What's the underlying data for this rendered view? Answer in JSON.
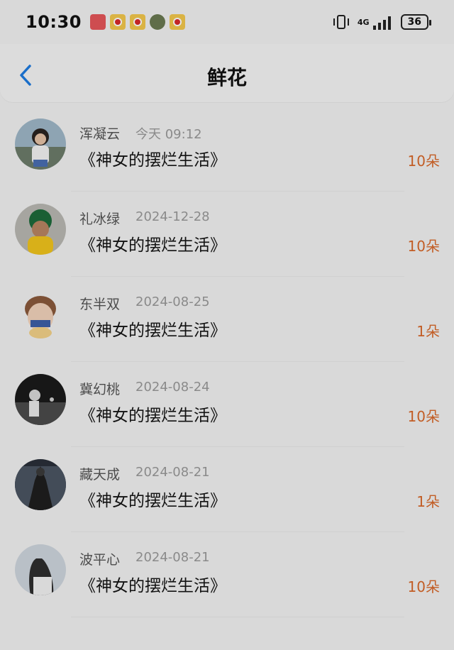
{
  "statusbar": {
    "time": "10:30",
    "notifications": [
      "red-app-icon",
      "weibo-icon",
      "weibo-icon",
      "game-avatar-icon",
      "weibo-icon"
    ],
    "network": "4G",
    "battery": "36"
  },
  "header": {
    "title": "鲜花",
    "back_icon": "chevron-left-icon"
  },
  "colors": {
    "accent": "#1e7be0",
    "count": "#d9682a"
  },
  "items": [
    {
      "name": "浑凝云",
      "date": "今天 09:12",
      "book": "《神女的摆烂生活》",
      "count": "10朵"
    },
    {
      "name": "礼冰绿",
      "date": "2024-12-28",
      "book": "《神女的摆烂生活》",
      "count": "10朵"
    },
    {
      "name": "东半双",
      "date": "2024-08-25",
      "book": "《神女的摆烂生活》",
      "count": "1朵"
    },
    {
      "name": "冀幻桃",
      "date": "2024-08-24",
      "book": "《神女的摆烂生活》",
      "count": "10朵"
    },
    {
      "name": "藏天成",
      "date": "2024-08-21",
      "book": "《神女的摆烂生活》",
      "count": "1朵"
    },
    {
      "name": "波平心",
      "date": "2024-08-21",
      "book": "《神女的摆烂生活》",
      "count": "10朵"
    }
  ]
}
